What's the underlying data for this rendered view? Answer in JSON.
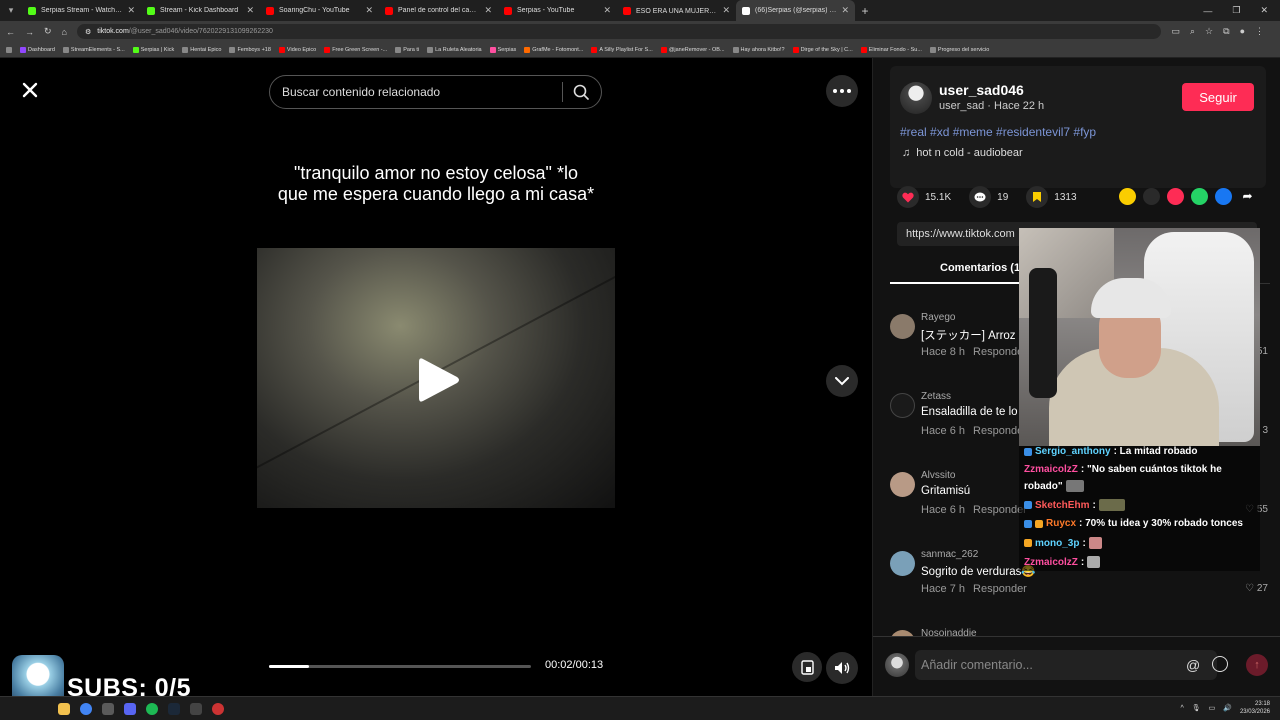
{
  "browser": {
    "tabs": [
      {
        "title": "Serpias Stream - Watch Live on",
        "color": "#53fc18"
      },
      {
        "title": "Stream - Kick Dashboard",
        "color": "#53fc18"
      },
      {
        "title": "SoaringChu - YouTube",
        "color": "#ff0000"
      },
      {
        "title": "Panel de control del canal - Yo",
        "color": "#ff0000"
      },
      {
        "title": "Serpias - YouTube",
        "color": "#ff0000"
      },
      {
        "title": "ESO ERA UNA MUJER? 😳 #mu",
        "color": "#ff0000"
      },
      {
        "title": "(66)Serpias (@serpias) | Tik",
        "color": "#ffffff"
      }
    ],
    "url_domain": "tiktok.com",
    "url_path": "/@user_sad046/video/7620229131099262230",
    "bookmarks": [
      "Dashboard",
      "StreamElements - S...",
      "Serpias | Kick",
      "Hentai Epico",
      "Femboys +18",
      "Video Epico",
      "Free Green Screen -...",
      "Para ti",
      "La Ruleta Aleatoria",
      "Serpias",
      "GrafMe - Fotomont...",
      "A Silly Playlist For S...",
      "@janeRemover - OB...",
      "Hay ahora Kitbo!?",
      "Dirge of the Sky | C...",
      "Eliminar Fondo - Su...",
      "Progreso del servicio"
    ]
  },
  "video": {
    "search_placeholder": "Buscar contenido relacionado",
    "caption": "\"tranquilo amor no estoy celosa\" *lo que me espera cuando llego a mi casa*",
    "time": "00:02/00:13",
    "progress": 0.154
  },
  "post": {
    "username": "user_sad046",
    "subline": "user_sad · Hace 22 h",
    "follow_label": "Seguir",
    "hashtags": "#real #xd #meme #residentevil7 #fyp",
    "music": "hot n cold - audiobear",
    "likes": "15.1K",
    "comments": "19",
    "saves": "1313",
    "link": "https://www.tiktok.com",
    "comments_tab": "Comentarios (19"
  },
  "comments": [
    {
      "name": "Rayego",
      "text": "[ステッカー] Arroz",
      "time": "Hace 8 h",
      "reply": "Responder",
      "likes": "51"
    },
    {
      "name": "Zetass",
      "text": "Ensaladilla de te lo",
      "time": "Hace 6 h",
      "reply": "Responder",
      "likes": "3"
    },
    {
      "name": "Alvssito",
      "text": "Gritamisú",
      "time": "Hace 6 h",
      "reply": "Responder",
      "likes": "55"
    },
    {
      "name": "sanmac_262",
      "text": "Sogrito de verduras😂",
      "time": "Hace 7 h",
      "reply": "Responder",
      "likes": "27"
    },
    {
      "name": "Nosoinaddie",
      "text": "",
      "time": "",
      "reply": "",
      "likes": ""
    }
  ],
  "comment_input": {
    "placeholder": "Añadir comentario..."
  },
  "chat": [
    {
      "user": "Sergio_anthony",
      "color": "#5fd3ff",
      "msg": ": La mitad robado"
    },
    {
      "user": "ZzmaicolzZ",
      "color": "#ff4fa0",
      "msg": ": \"No saben cuántos tiktok he"
    },
    {
      "user": "",
      "color": "#ffffff",
      "msg": "robado\""
    },
    {
      "user": "SketchEhm",
      "color": "#ff5a5a",
      "msg": ":"
    },
    {
      "user": "Ruycx",
      "color": "#ff7a2a",
      "msg": ": 70% tu idea y 30% robado tonces"
    },
    {
      "user": "mono_3p",
      "color": "#5fd3ff",
      "msg": ":"
    },
    {
      "user": "ZzmaicolzZ",
      "color": "#ff4fa0",
      "msg": ":"
    }
  ],
  "overlay": {
    "subs": "SUBS: 0/5"
  },
  "taskbar": {
    "time": "23:18",
    "date": "23/03/2026"
  },
  "colors": {
    "accent": "#fe2c55",
    "hashtag": "#7c95d6"
  }
}
